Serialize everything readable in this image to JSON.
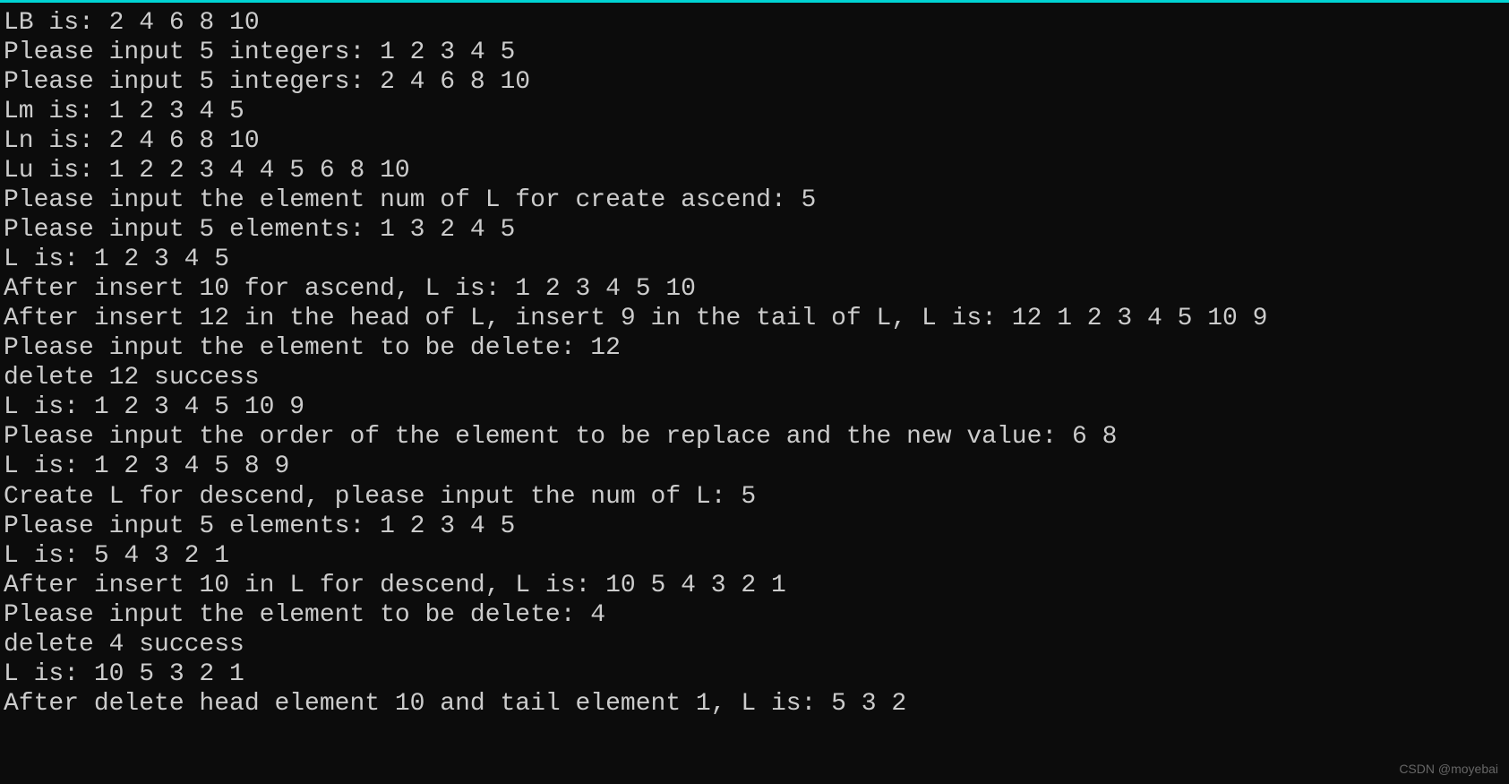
{
  "terminal": {
    "lines": [
      "LB is: 2 4 6 8 10",
      "Please input 5 integers: 1 2 3 4 5",
      "Please input 5 integers: 2 4 6 8 10",
      "Lm is: 1 2 3 4 5",
      "Ln is: 2 4 6 8 10",
      "Lu is: 1 2 2 3 4 4 5 6 8 10",
      "Please input the element num of L for create ascend: 5",
      "Please input 5 elements: 1 3 2 4 5",
      "L is: 1 2 3 4 5",
      "After insert 10 for ascend, L is: 1 2 3 4 5 10",
      "After insert 12 in the head of L, insert 9 in the tail of L, L is: 12 1 2 3 4 5 10 9",
      "Please input the element to be delete: 12",
      "delete 12 success",
      "L is: 1 2 3 4 5 10 9",
      "Please input the order of the element to be replace and the new value: 6 8",
      "L is: 1 2 3 4 5 8 9",
      "Create L for descend, please input the num of L: 5",
      "Please input 5 elements: 1 2 3 4 5",
      "L is: 5 4 3 2 1",
      "After insert 10 in L for descend, L is: 10 5 4 3 2 1",
      "Please input the element to be delete: 4",
      "delete 4 success",
      "L is: 10 5 3 2 1",
      "After delete head element 10 and tail element 1, L is: 5 3 2"
    ]
  },
  "watermark": "CSDN @moyebai"
}
